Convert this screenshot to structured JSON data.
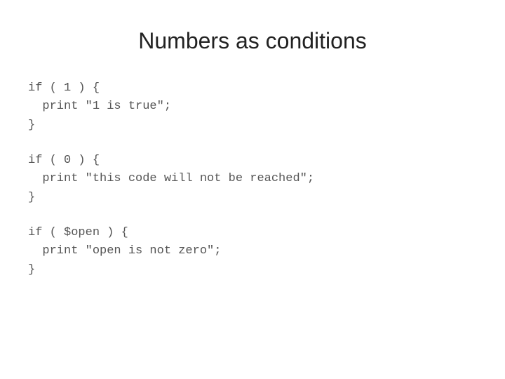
{
  "page": {
    "title": "Numbers as conditions",
    "code_blocks": [
      {
        "id": "block1",
        "lines": [
          "if ( 1 ) {",
          "  print \"1 is true\";",
          "}"
        ]
      },
      {
        "id": "block2",
        "lines": [
          "if ( 0 ) {",
          "  print \"this code will not be reached\";",
          "}"
        ]
      },
      {
        "id": "block3",
        "lines": [
          "if ( $open ) {",
          "  print \"open is not zero\";",
          "}"
        ]
      }
    ]
  }
}
